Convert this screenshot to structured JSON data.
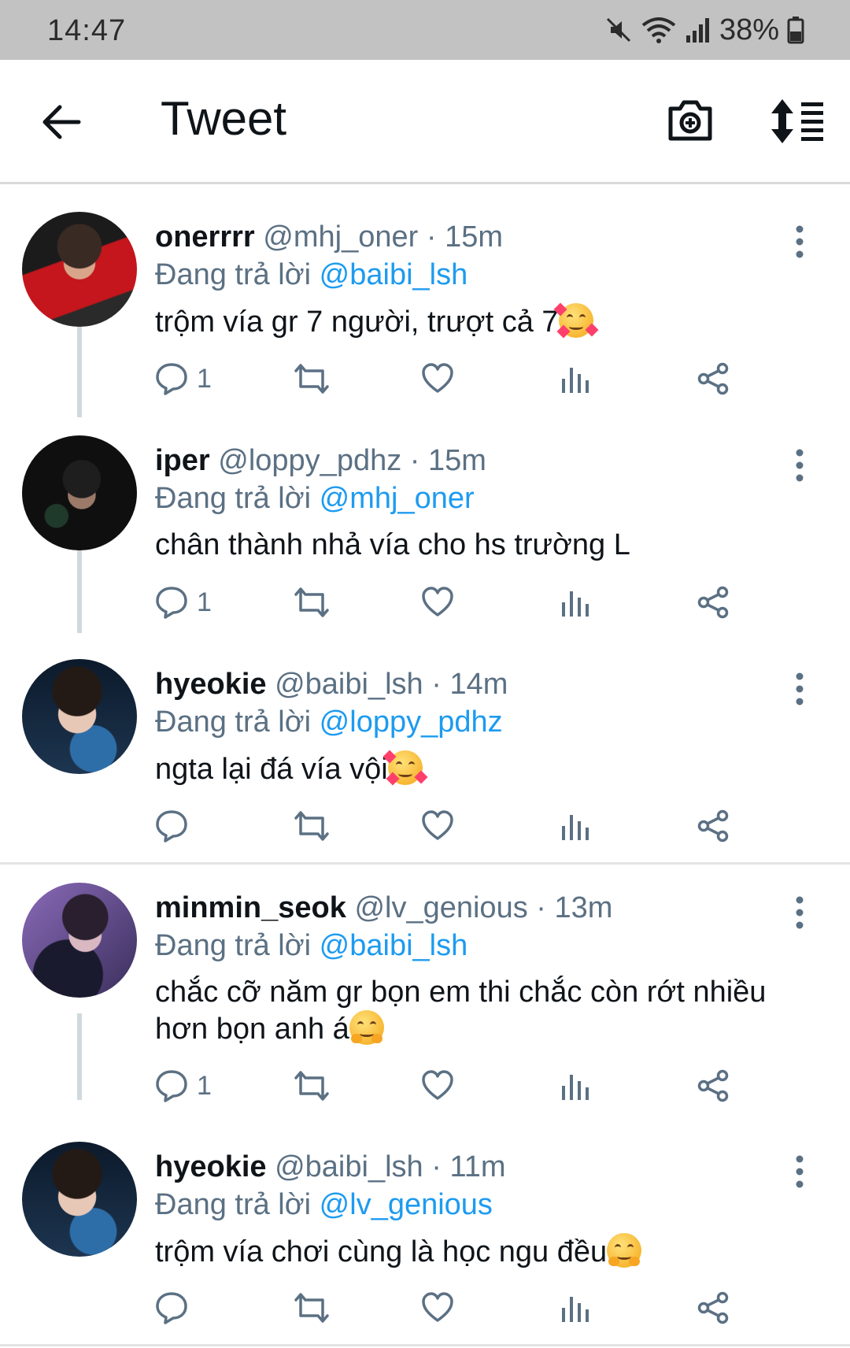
{
  "status_bar": {
    "time": "14:47",
    "battery": "38%"
  },
  "app_bar": {
    "title": "Tweet"
  },
  "tweets": [
    {
      "name": "onerrrr",
      "handle": "@mhj_oner",
      "time": "15m",
      "replying_prefix": "Đang trả lời",
      "replying_to": "@baibi_lsh",
      "text": "trộm vía gr 7 người, trượt cả 7",
      "emoji": "smiling-face-with-hearts",
      "reply_count": "1"
    },
    {
      "name": "iper",
      "handle": "@loppy_pdhz",
      "time": "15m",
      "replying_prefix": "Đang trả lời",
      "replying_to": "@mhj_oner",
      "text": "chân thành nhả vía cho hs trường L",
      "emoji": "",
      "reply_count": "1"
    },
    {
      "name": "hyeokie",
      "handle": "@baibi_lsh",
      "time": "14m",
      "replying_prefix": "Đang trả lời",
      "replying_to": "@loppy_pdhz",
      "text": "ngta lại đá vía vội",
      "emoji": "smiling-face-with-hearts",
      "reply_count": ""
    },
    {
      "name": "minmin_seok",
      "handle": "@lv_genious",
      "time": "13m",
      "replying_prefix": "Đang trả lời",
      "replying_to": "@baibi_lsh",
      "text": "chắc cỡ năm gr bọn em thi chắc còn rớt nhiều hơn bọn anh á",
      "emoji": "hugging-face",
      "reply_count": "1"
    },
    {
      "name": "hyeokie",
      "handle": "@baibi_lsh",
      "time": "11m",
      "replying_prefix": "Đang trả lời",
      "replying_to": "@lv_genious",
      "text": "trộm vía chơi cùng là học ngu đều",
      "emoji": "hugging-face",
      "reply_count": ""
    }
  ],
  "icons": [
    "back-arrow-icon",
    "camera-plus-icon",
    "sort-icon",
    "reply-icon",
    "retweet-icon",
    "like-icon",
    "analytics-icon",
    "share-icon",
    "more-vertical-icon"
  ],
  "colors": {
    "status_bar": "#c2c2c2",
    "mention": "#1d9bf0",
    "meta": "#5b7083",
    "text": "#0f1419"
  }
}
